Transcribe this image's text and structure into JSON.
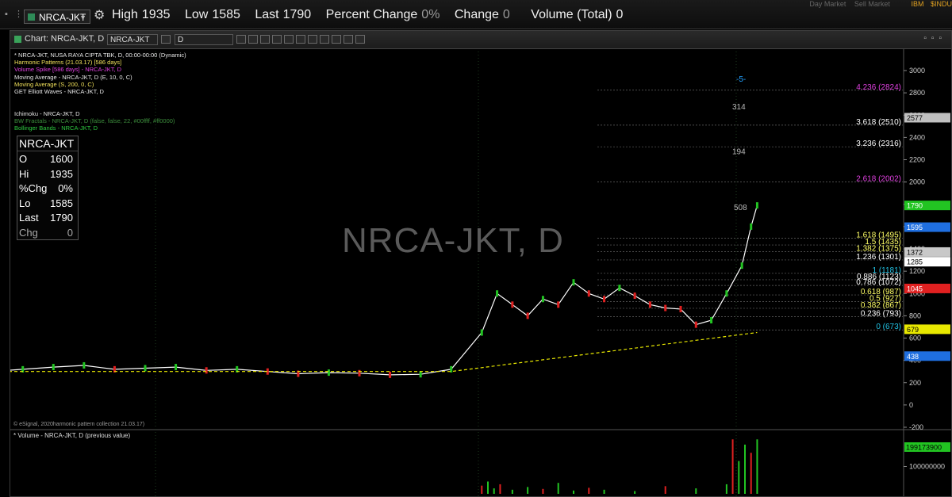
{
  "quote_bar": {
    "symbol": "NRCA-JKT",
    "fields": [
      {
        "label": "High",
        "value": "1935"
      },
      {
        "label": "Low",
        "value": "1585"
      },
      {
        "label": "Last",
        "value": "1790"
      },
      {
        "label": "Percent Change",
        "value": "0%"
      },
      {
        "label": "Change",
        "value": "0"
      },
      {
        "label": "Volume (Total)",
        "value": "0"
      }
    ],
    "right_fragments": [
      "Day Market",
      "Sell Market",
      "IBM",
      "$INDU"
    ]
  },
  "chart_window": {
    "title": "Chart: NRCA-JKT, D",
    "symbol_field": "NRCA-JKT",
    "interval_field": "D",
    "watermark": "NRCA-JKT, D",
    "copyright": "© eSignal, 2020harmonic pattern collection 21.03.17)",
    "volume_label": "* Volume - NRCA-JKT, D (previous value)"
  },
  "legend": [
    {
      "text": "* NRCA-JKT, NUSA RAYA CIPTA TBK, D, 00:00-00:00 (Dynamic)",
      "color": "#e6e6e6"
    },
    {
      "text": "Harmonic Patterns (21.03.17) [586 days]",
      "color": "#f1e15b"
    },
    {
      "text": "Volume Spike [586 days] - NRCA-JKT, D",
      "color": "#e040e0"
    },
    {
      "text": "Moving Average - NRCA-JKT, D (E, 10, 0, C)",
      "color": "#e6e6e6"
    },
    {
      "text": "Moving Average (S, 200, 0, C)",
      "color": "#f1e15b"
    },
    {
      "text": "GET Elliott Waves - NRCA-JKT, D",
      "color": "#e6e6e6"
    },
    {
      "text": "",
      "color": "#e6e6e6"
    },
    {
      "text": "",
      "color": "#e6e6e6"
    },
    {
      "text": "Ichimoku - NRCA-JKT, D",
      "color": "#e6e6e6"
    },
    {
      "text": "BW Fractals - NRCA-JKT, D (false, false, 22, #00ffff, #ff0000)",
      "color": "#3c8d3c"
    },
    {
      "text": "Bollinger Bands - NRCA-JKT, D",
      "color": "#2ecc40"
    }
  ],
  "data_window": {
    "title": "NRCA-JKT",
    "rows": [
      {
        "k": "O",
        "v": "1600"
      },
      {
        "k": "Hi",
        "v": "1935"
      },
      {
        "k": "%Chg",
        "v": "0%"
      },
      {
        "k": "Lo",
        "v": "1585"
      },
      {
        "k": "Last",
        "v": "1790"
      },
      {
        "k": "Chg",
        "v": "0"
      }
    ]
  },
  "chart_data": {
    "type": "line",
    "title": "NRCA-JKT, D",
    "ylim": [
      -200,
      3000
    ],
    "y_ticks": [
      3000,
      2800,
      2600,
      2400,
      2200,
      2000,
      1800,
      1600,
      1400,
      1200,
      1000,
      800,
      600,
      400,
      200,
      0,
      -200
    ],
    "price_badges": [
      {
        "label": "2577",
        "y": 2577,
        "color": "#c0c0c0",
        "text_color": "#000"
      },
      {
        "label": "1790",
        "y": 1790,
        "color": "#22c422",
        "text_color": "#fff"
      },
      {
        "label": "1595",
        "y": 1595,
        "color": "#1f6fe0",
        "text_color": "#fff"
      },
      {
        "label": "1372",
        "y": 1372,
        "color": "#c8c8c8",
        "text_color": "#000"
      },
      {
        "label": "1285",
        "y": 1285,
        "color": "#ffffff",
        "text_color": "#000"
      },
      {
        "label": "1045",
        "y": 1045,
        "color": "#e02020",
        "text_color": "#fff"
      },
      {
        "label": "679",
        "y": 679,
        "color": "#e8e800",
        "text_color": "#000"
      },
      {
        "label": "438",
        "y": 438,
        "color": "#1f6fe0",
        "text_color": "#fff"
      }
    ],
    "fib_levels": [
      {
        "label": "4.236 (2824)",
        "y": 2824,
        "color": "#e040e0"
      },
      {
        "label": "3.618 (2510)",
        "y": 2510,
        "color": "#ffffff"
      },
      {
        "label": "3.236 (2316)",
        "y": 2316,
        "color": "#ffffff"
      },
      {
        "label": "2.618 (2002)",
        "y": 2002,
        "color": "#e040e0"
      },
      {
        "label": "1.618 (1495)",
        "y": 1495,
        "color": "#ffff66"
      },
      {
        "label": "1.5 (1435)",
        "y": 1435,
        "color": "#ffff66"
      },
      {
        "label": "1.382 (1375)",
        "y": 1375,
        "color": "#ffff66"
      },
      {
        "label": "1.236 (1301)",
        "y": 1301,
        "color": "#ffffff"
      },
      {
        "label": "1 (1181)",
        "y": 1181,
        "color": "#22c4e6"
      },
      {
        "label": "0.886 (1123)",
        "y": 1123,
        "color": "#ffffff"
      },
      {
        "label": "0.786 (1072)",
        "y": 1072,
        "color": "#ffffff"
      },
      {
        "label": "0.618 (987)",
        "y": 987,
        "color": "#ffff66"
      },
      {
        "label": "0.5 (927)",
        "y": 927,
        "color": "#ffff66"
      },
      {
        "label": "0.382 (867)",
        "y": 867,
        "color": "#ffff66"
      },
      {
        "label": "0.236 (793)",
        "y": 793,
        "color": "#ffffff"
      },
      {
        "label": "0 (673)",
        "y": 673,
        "color": "#22c4e6"
      }
    ],
    "wave_counts": [
      {
        "label": "-5-",
        "y": 2900,
        "color": "#22a0ff"
      },
      {
        "label": "314",
        "y": 2650,
        "color": "#bbbbbb"
      },
      {
        "label": "194",
        "y": 2250,
        "color": "#bbbbbb"
      },
      {
        "label": "508",
        "y": 1750,
        "color": "#bbbbbb"
      }
    ],
    "price_series": [
      {
        "x": 0,
        "y": 300
      },
      {
        "x": 10,
        "y": 295
      },
      {
        "x": 20,
        "y": 300
      },
      {
        "x": 30,
        "y": 320
      },
      {
        "x": 40,
        "y": 340
      },
      {
        "x": 50,
        "y": 355
      },
      {
        "x": 60,
        "y": 320
      },
      {
        "x": 70,
        "y": 330
      },
      {
        "x": 80,
        "y": 340
      },
      {
        "x": 90,
        "y": 310
      },
      {
        "x": 100,
        "y": 320
      },
      {
        "x": 110,
        "y": 300
      },
      {
        "x": 120,
        "y": 280
      },
      {
        "x": 130,
        "y": 290
      },
      {
        "x": 140,
        "y": 285
      },
      {
        "x": 150,
        "y": 270
      },
      {
        "x": 160,
        "y": 275
      },
      {
        "x": 170,
        "y": 320
      },
      {
        "x": 180,
        "y": 650
      },
      {
        "x": 185,
        "y": 1000
      },
      {
        "x": 190,
        "y": 900
      },
      {
        "x": 195,
        "y": 800
      },
      {
        "x": 200,
        "y": 950
      },
      {
        "x": 205,
        "y": 900
      },
      {
        "x": 210,
        "y": 1100
      },
      {
        "x": 215,
        "y": 1000
      },
      {
        "x": 220,
        "y": 950
      },
      {
        "x": 225,
        "y": 1050
      },
      {
        "x": 230,
        "y": 980
      },
      {
        "x": 235,
        "y": 900
      },
      {
        "x": 240,
        "y": 870
      },
      {
        "x": 245,
        "y": 860
      },
      {
        "x": 250,
        "y": 720
      },
      {
        "x": 255,
        "y": 760
      },
      {
        "x": 260,
        "y": 1000
      },
      {
        "x": 265,
        "y": 1250
      },
      {
        "x": 268,
        "y": 1600
      },
      {
        "x": 270,
        "y": 1790
      }
    ],
    "volume": {
      "ylim": [
        0,
        200000000
      ],
      "y_ticks": [
        100000000
      ],
      "last_label": "199173900",
      "bars": [
        {
          "x": 180,
          "v": 30000000
        },
        {
          "x": 182,
          "v": 45000000
        },
        {
          "x": 184,
          "v": 20000000
        },
        {
          "x": 186,
          "v": 35000000
        },
        {
          "x": 190,
          "v": 15000000
        },
        {
          "x": 195,
          "v": 25000000
        },
        {
          "x": 200,
          "v": 18000000
        },
        {
          "x": 205,
          "v": 40000000
        },
        {
          "x": 210,
          "v": 12000000
        },
        {
          "x": 215,
          "v": 22000000
        },
        {
          "x": 220,
          "v": 15000000
        },
        {
          "x": 230,
          "v": 10000000
        },
        {
          "x": 240,
          "v": 28000000
        },
        {
          "x": 250,
          "v": 20000000
        },
        {
          "x": 260,
          "v": 35000000
        },
        {
          "x": 262,
          "v": 199173900
        },
        {
          "x": 264,
          "v": 120000000
        },
        {
          "x": 266,
          "v": 180000000
        },
        {
          "x": 268,
          "v": 150000000
        },
        {
          "x": 270,
          "v": 199173900
        }
      ]
    }
  }
}
